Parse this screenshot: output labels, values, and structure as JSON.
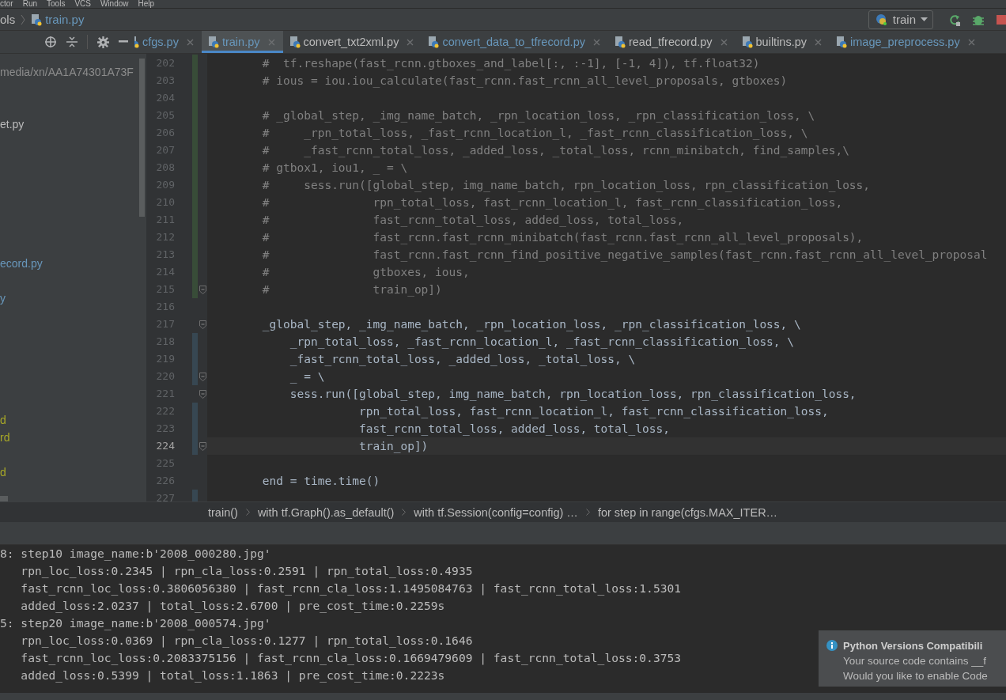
{
  "menu_bar": [
    "ctor",
    "Run",
    "Tools",
    "VCS",
    "Window",
    "Help"
  ],
  "nav_bar": {
    "crumbs": [
      "ols",
      "train.py"
    ],
    "run_config": "train"
  },
  "tabs": [
    {
      "label": "cfgs.py",
      "modified": true,
      "selected": false
    },
    {
      "label": "train.py",
      "modified": true,
      "selected": true
    },
    {
      "label": "convert_txt2xml.py",
      "modified": false,
      "selected": false
    },
    {
      "label": "convert_data_to_tfrecord.py",
      "modified": true,
      "selected": false
    },
    {
      "label": "read_tfrecord.py",
      "modified": false,
      "selected": false
    },
    {
      "label": "builtins.py",
      "modified": false,
      "selected": false
    },
    {
      "label": "image_preprocess.py",
      "modified": true,
      "selected": false
    }
  ],
  "project_tree": [
    {
      "text": "media/xn/AA1A74301A73F",
      "kind": "path"
    },
    {
      "text": "et.py",
      "kind": "file"
    },
    {
      "text": "ecord.py",
      "kind": "modified"
    },
    {
      "text": "y",
      "kind": "modified"
    },
    {
      "text": "d",
      "kind": "ignored"
    },
    {
      "text": "rd",
      "kind": "ignored"
    },
    {
      "text": "d",
      "kind": "ignored"
    }
  ],
  "code_lines": [
    {
      "n": "202",
      "kind": "comment",
      "text": "        #  tf.reshape(fast_rcnn.gtboxes_and_label[:, :-1], [-1, 4]), tf.float32)",
      "added": true,
      "modified": false,
      "current": false
    },
    {
      "n": "203",
      "kind": "comment",
      "text": "        # ious = iou.iou_calculate(fast_rcnn.fast_rcnn_all_level_proposals, gtboxes)",
      "added": true,
      "modified": false,
      "current": false
    },
    {
      "n": "204",
      "kind": "code",
      "added": true,
      "modified": false,
      "current": false
    },
    {
      "n": "205",
      "kind": "comment",
      "text": "        # _global_step, _img_name_batch, _rpn_location_loss, _rpn_classification_loss, \\",
      "added": true,
      "modified": false,
      "current": false
    },
    {
      "n": "206",
      "kind": "comment",
      "text": "        #     _rpn_total_loss, _fast_rcnn_location_l, _fast_rcnn_classification_loss, \\",
      "added": true,
      "modified": false,
      "current": false
    },
    {
      "n": "207",
      "kind": "comment",
      "text": "        #     _fast_rcnn_total_loss, _added_loss, _total_loss, rcnn_minibatch, find_samples,\\",
      "added": true,
      "modified": false,
      "current": false
    },
    {
      "n": "208",
      "kind": "comment",
      "text": "        # gtbox1, iou1, _ = \\",
      "added": true,
      "modified": false,
      "current": false
    },
    {
      "n": "209",
      "kind": "comment",
      "text": "        #     sess.run([global_step, img_name_batch, rpn_location_loss, rpn_classification_loss,",
      "added": true,
      "modified": false,
      "current": false
    },
    {
      "n": "210",
      "kind": "comment",
      "text": "        #               rpn_total_loss, fast_rcnn_location_l, fast_rcnn_classification_loss,",
      "added": true,
      "modified": false,
      "current": false
    },
    {
      "n": "211",
      "kind": "comment",
      "text": "        #               fast_rcnn_total_loss, added_loss, total_loss,",
      "added": true,
      "modified": false,
      "current": false
    },
    {
      "n": "212",
      "kind": "comment",
      "text": "        #               fast_rcnn.fast_rcnn_minibatch(fast_rcnn.fast_rcnn_all_level_proposals),",
      "added": true,
      "modified": false,
      "current": false
    },
    {
      "n": "213",
      "kind": "comment",
      "text": "        #               fast_rcnn.fast_rcnn_find_positive_negative_samples(fast_rcnn.fast_rcnn_all_level_proposal",
      "added": true,
      "modified": false,
      "current": false
    },
    {
      "n": "214",
      "kind": "comment",
      "text": "        #               gtboxes, ious,",
      "added": true,
      "modified": false,
      "current": false
    },
    {
      "n": "215",
      "kind": "comment",
      "text": "        #               train_op])",
      "added": true,
      "modified": false,
      "current": false
    },
    {
      "n": "216",
      "kind": "code",
      "added": false,
      "modified": false,
      "current": false
    },
    {
      "n": "217",
      "kind": "code",
      "text": "        _global_step, _img_name_batch, _rpn_location_loss, _rpn_classification_loss, \\",
      "added": false,
      "modified": false,
      "current": false
    },
    {
      "n": "218",
      "kind": "code",
      "text": "            _rpn_total_loss, _fast_rcnn_location_l, _fast_rcnn_classification_loss, \\",
      "added": false,
      "modified": true,
      "current": false
    },
    {
      "n": "219",
      "kind": "code",
      "text": "            _fast_rcnn_total_loss, _added_loss, _total_loss, \\",
      "added": false,
      "modified": true,
      "current": false
    },
    {
      "n": "220",
      "kind": "code",
      "text": "            _ = \\",
      "added": false,
      "modified": true,
      "current": false
    },
    {
      "n": "221",
      "kind": "code",
      "text": "            sess.run([global_step, img_name_batch, rpn_location_loss, rpn_classification_loss,",
      "added": false,
      "modified": false,
      "current": false
    },
    {
      "n": "222",
      "kind": "code",
      "text": "                      rpn_total_loss, fast_rcnn_location_l, fast_rcnn_classification_loss,",
      "added": false,
      "modified": true,
      "current": false
    },
    {
      "n": "223",
      "kind": "code",
      "text": "                      fast_rcnn_total_loss, added_loss, total_loss,",
      "added": false,
      "modified": true,
      "current": false
    },
    {
      "n": "224",
      "kind": "code",
      "text": "                      train_op])",
      "added": false,
      "modified": true,
      "current": true
    },
    {
      "n": "225",
      "kind": "code",
      "added": false,
      "modified": false,
      "current": false
    },
    {
      "n": "226",
      "kind": "code",
      "text": "        end = time.time()",
      "added": false,
      "modified": false,
      "current": false
    },
    {
      "n": "227",
      "kind": "code",
      "added": false,
      "modified": true,
      "current": false
    }
  ],
  "breadcrumbs": [
    "train()",
    "with tf.Graph().as_default()",
    "with tf.Session(config=config) …",
    "for step in range(cfgs.MAX_ITER…"
  ],
  "console_lines": [
    "8: step10 image_name:b'2008_000280.jpg'",
    "   rpn_loc_loss:0.2345 | rpn_cla_loss:0.2591 | rpn_total_loss:0.4935",
    "   fast_rcnn_loc_loss:0.3806056380 | fast_rcnn_cla_loss:1.1495084763 | fast_rcnn_total_loss:1.5301",
    "   added_loss:2.0237 | total_loss:2.6700 | pre_cost_time:0.2259s",
    "5: step20 image_name:b'2008_000574.jpg'",
    "   rpn_loc_loss:0.0369 | rpn_cla_loss:0.1277 | rpn_total_loss:0.1646",
    "   fast_rcnn_loc_loss:0.2083375156 | fast_rcnn_cla_loss:0.1669479609 | fast_rcnn_total_loss:0.3753",
    "   added_loss:0.5399 | total_loss:1.1863 | pre_cost_time:0.2223s"
  ],
  "notification": {
    "title": "Python Versions Compatibili",
    "lines": [
      "Your source code contains __f",
      "Would you like to enable Code"
    ]
  }
}
